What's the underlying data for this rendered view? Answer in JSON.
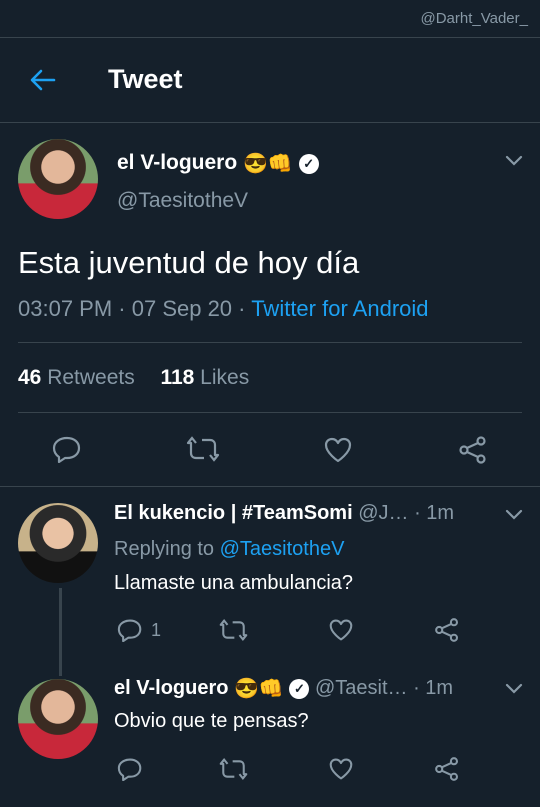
{
  "watermark": "@Darht_Vader_",
  "header": {
    "title": "Tweet"
  },
  "main_tweet": {
    "display_name": "el V-loguero",
    "emojis": "😎👊",
    "handle": "@TaesitotheV",
    "text": "Esta juventud de hoy día",
    "time": "03:07 PM",
    "sep1": " · ",
    "date": "07 Sep 20",
    "sep2": " · ",
    "source": "Twitter for Android",
    "retweets_count": "46",
    "retweets_label": "Retweets",
    "likes_count": "118",
    "likes_label": "Likes"
  },
  "replies": [
    {
      "display_name": "El kukencio | #TeamSomi",
      "handle": "@J…",
      "time": "· 1m",
      "replying_prefix": "Replying to",
      "replying_handle": "@TaesitotheV",
      "text": "Llamaste una ambulancia?",
      "reply_count": "1"
    },
    {
      "display_name": "el V-loguero",
      "emojis": "😎👊",
      "handle": "@Taesit…",
      "time": "· 1m",
      "text": "Obvio que te pensas?"
    }
  ],
  "colors": {
    "background": "#15202b",
    "accent": "#1da1f2",
    "muted": "#8899a6",
    "divider": "#38444d"
  },
  "icons": [
    "back-arrow-icon",
    "verified-badge-icon",
    "chevron-down-icon",
    "reply-icon",
    "retweet-icon",
    "like-icon",
    "share-icon"
  ]
}
